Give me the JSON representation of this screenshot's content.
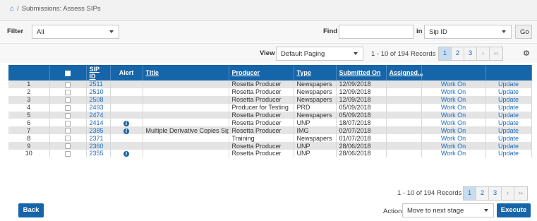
{
  "breadcrumb": {
    "separator": "/",
    "title": "Submissions: Assess SIPs"
  },
  "filter": {
    "label": "Filter",
    "value": "All"
  },
  "find": {
    "label": "Find",
    "value": "",
    "in_label": "in",
    "in_value": "Sip ID",
    "go_label": "Go"
  },
  "view": {
    "label": "View",
    "value": "Default Paging"
  },
  "records_label": "1 - 10 of 194 Records",
  "pager": {
    "pages": [
      "1",
      "2",
      "3"
    ],
    "next": "›",
    "last": "››",
    "active": "1"
  },
  "columns": {
    "sip_id": "SIP ID",
    "alert": "Alert",
    "title": "Title",
    "producer": "Producer",
    "type": "Type",
    "submitted_on": "Submitted On",
    "assigned": "Assigned..."
  },
  "rows": [
    {
      "num": "1",
      "sip": "2511",
      "alert": false,
      "title": "",
      "producer": "Rosetta Producer",
      "type": "Newspapers",
      "date": "12/09/2018",
      "work": "Work On",
      "update": "Update"
    },
    {
      "num": "2",
      "sip": "2510",
      "alert": false,
      "title": "",
      "producer": "Rosetta Producer",
      "type": "Newspapers",
      "date": "12/09/2018",
      "work": "Work On",
      "update": "Update"
    },
    {
      "num": "3",
      "sip": "2508",
      "alert": false,
      "title": "",
      "producer": "Rosetta Producer",
      "type": "Newspapers",
      "date": "12/09/2018",
      "work": "Work On",
      "update": "Update"
    },
    {
      "num": "4",
      "sip": "2493",
      "alert": false,
      "title": "",
      "producer": "Producer for Testing",
      "type": "PRD",
      "date": "05/09/2018",
      "work": "Work On",
      "update": "Update"
    },
    {
      "num": "5",
      "sip": "2474",
      "alert": false,
      "title": "",
      "producer": "Rosetta Producer",
      "type": "Newspapers",
      "date": "05/09/2018",
      "work": "Work On",
      "update": "Update"
    },
    {
      "num": "6",
      "sip": "2414",
      "alert": true,
      "title": "",
      "producer": "Rosetta Producer",
      "type": "UNP",
      "date": "18/07/2018",
      "work": "Work On",
      "update": "Update"
    },
    {
      "num": "7",
      "sip": "2385",
      "alert": true,
      "title": "Multiple Derivative Copies Sip",
      "producer": "Rosetta Producer",
      "type": "IMG",
      "date": "02/07/2018",
      "work": "Work On",
      "update": "Update"
    },
    {
      "num": "8",
      "sip": "2371",
      "alert": false,
      "title": "",
      "producer": "Training",
      "type": "Newspapers",
      "date": "01/07/2018",
      "work": "Work On",
      "update": "Update"
    },
    {
      "num": "9",
      "sip": "2360",
      "alert": false,
      "title": "",
      "producer": "Rosetta Producer",
      "type": "UNP",
      "date": "28/06/2018",
      "work": "Work On",
      "update": "Update"
    },
    {
      "num": "10",
      "sip": "2355",
      "alert": true,
      "title": "",
      "producer": "Rosetta Producer",
      "type": "UNP",
      "date": "28/06/2018",
      "work": "Work On",
      "update": "Update"
    }
  ],
  "footer": {
    "back_label": "Back",
    "action_label": "Action",
    "action_value": "Move to next stage",
    "execute_label": "Execute"
  },
  "colors": {
    "header_blue": "#1765a9",
    "link_blue": "#1b6cc1",
    "row_alt": "#e4e4e4"
  },
  "icons": {
    "home": "home-icon",
    "gear": "gear-icon",
    "alert": "info-icon"
  }
}
